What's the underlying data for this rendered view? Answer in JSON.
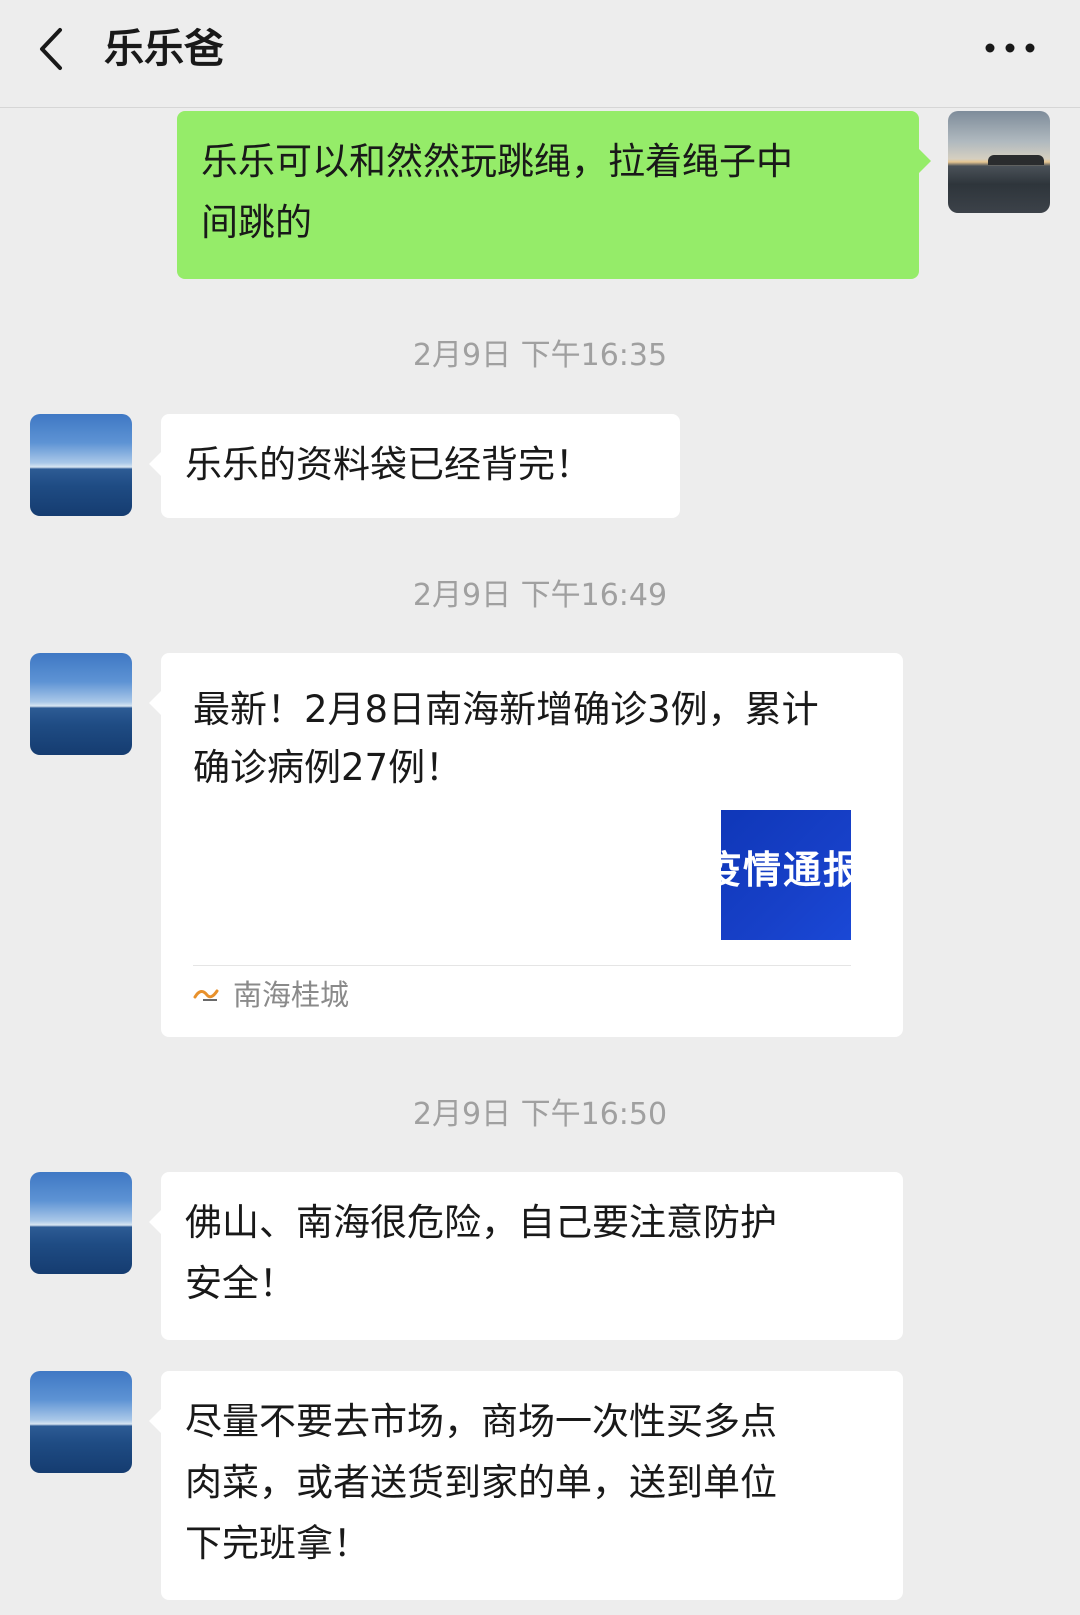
{
  "header": {
    "title": "乐乐爸",
    "back_icon": "chevron-left-icon",
    "more_icon": "ellipsis-icon"
  },
  "messages": [
    {
      "type": "text",
      "side": "right",
      "avatar": "sunset-island-avatar",
      "lines": [
        "乐乐可以和然然玩跳绳，拉着绳子中",
        "间跳的"
      ]
    },
    {
      "type": "timestamp",
      "text": "2月9日 下午16:35"
    },
    {
      "type": "text",
      "side": "left",
      "avatar": "sea-horizon-avatar",
      "lines": [
        "乐乐的资料袋已经背完！"
      ]
    },
    {
      "type": "timestamp",
      "text": "2月9日 下午16:49"
    },
    {
      "type": "card",
      "side": "left",
      "avatar": "sea-horizon-avatar",
      "title": "最新！2月8日南海新增确诊3例，累计确诊病例27例！",
      "thumb_text": "疫情通报",
      "source": "南海桂城",
      "source_icon": "guicheng-logo-icon"
    },
    {
      "type": "timestamp",
      "text": "2月9日 下午16:50"
    },
    {
      "type": "text",
      "side": "left",
      "avatar": "sea-horizon-avatar",
      "lines": [
        "佛山、南海很危险，自己要注意防护",
        "安全！"
      ]
    },
    {
      "type": "text",
      "side": "left",
      "avatar": "sea-horizon-avatar",
      "lines": [
        "尽量不要去市场，商场一次性买多点",
        "肉菜，或者送货到家的单，送到单位",
        "下完班拿！"
      ]
    }
  ],
  "colors": {
    "background": "#ededed",
    "sent_bubble": "#95ec69",
    "received_bubble": "#ffffff",
    "timestamp_text": "#a0a0a0",
    "card_thumb": "#1740c8"
  }
}
